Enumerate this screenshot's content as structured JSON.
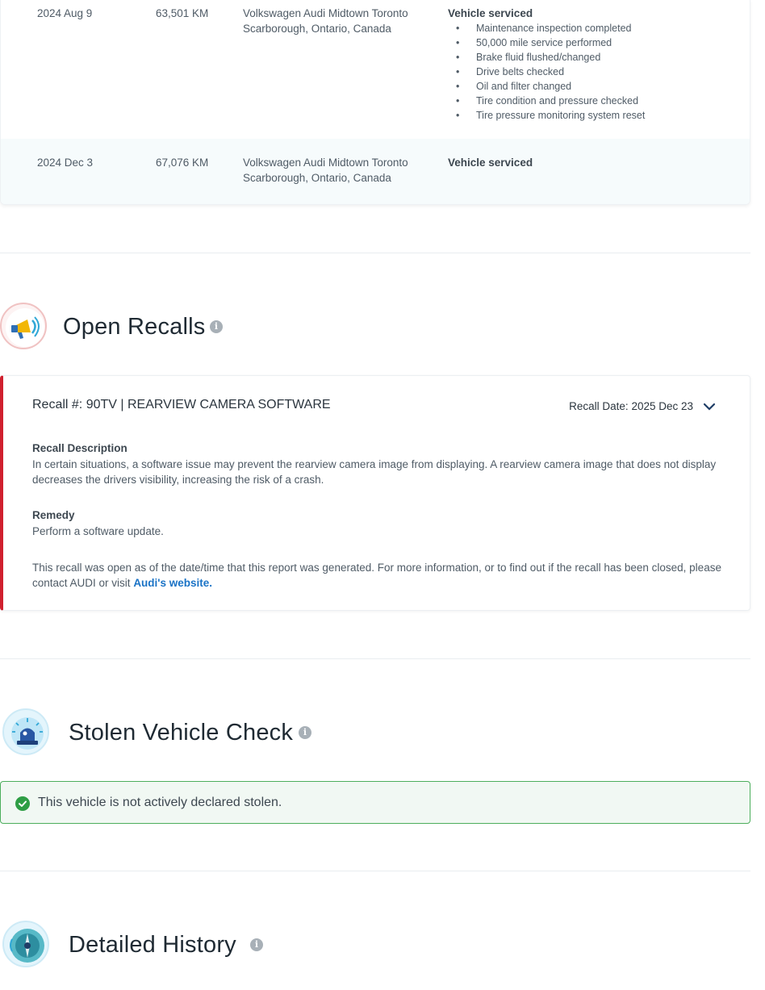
{
  "service_history": {
    "rows": [
      {
        "date": "2024 Aug 9",
        "odometer": "63,501 KM",
        "location_line1": "Volkswagen Audi Midtown Toronto",
        "location_line2": "Scarborough, Ontario, Canada",
        "detail_title": "Vehicle serviced",
        "items": [
          "Maintenance inspection completed",
          "50,000 mile service performed",
          "Brake fluid flushed/changed",
          "Drive belts checked",
          "Oil and filter changed",
          "Tire condition and pressure checked",
          "Tire pressure monitoring system reset"
        ]
      },
      {
        "date": "2024 Dec 3",
        "odometer": "67,076 KM",
        "location_line1": "Volkswagen Audi Midtown Toronto",
        "location_line2": "Scarborough, Ontario, Canada",
        "detail_title": "Vehicle serviced"
      }
    ]
  },
  "open_recalls": {
    "title": "Open Recalls",
    "icon": "megaphone-icon",
    "info_glyph": "i",
    "recall": {
      "heading": "Recall #: 90TV | REARVIEW CAMERA SOFTWARE",
      "date": "Recall Date: 2025 Dec 23",
      "description_label": "Recall Description",
      "description": "In certain situations, a software issue may prevent the rearview camera image from displaying. A rearview camera image that does not display decreases the drivers visibility, increasing the risk of a crash.",
      "remedy_label": "Remedy",
      "remedy": "Perform a software update.",
      "notice": "This recall was open as of the date/time that this report was generated. For more information, or to find out if the recall has been closed, please contact AUDI or visit",
      "link_text": "Audi's website."
    },
    "accent_color": "#d0202e"
  },
  "stolen_check": {
    "title": "Stolen Vehicle Check",
    "icon": "siren-icon",
    "info_glyph": "i",
    "status_text": "This vehicle is not actively declared stolen.",
    "status_color": "#2e9e45"
  },
  "detailed_history": {
    "title": "Detailed History",
    "icon": "compass-icon",
    "info_glyph": "i"
  }
}
